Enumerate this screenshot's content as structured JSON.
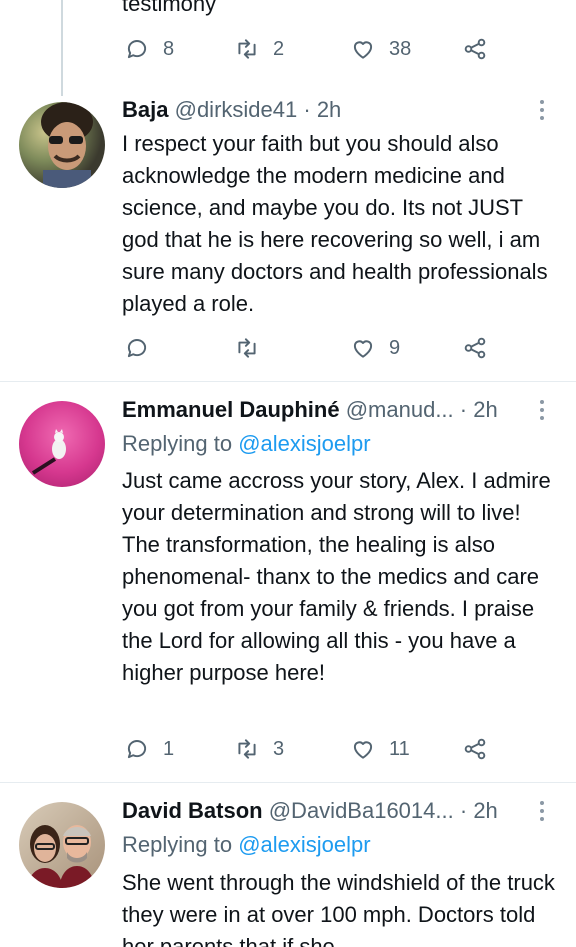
{
  "prev_tweet": {
    "tail_text": "testimony",
    "actions": {
      "replies": "8",
      "retweets": "2",
      "likes": "38"
    }
  },
  "tweets": [
    {
      "name": "Baja",
      "handle": "@dirkside41",
      "sep": "·",
      "time": "2h",
      "text": "I respect your faith but you should also acknowledge the modern medicine and science, and maybe you do. Its not JUST god that he is here recovering so well, i am sure many doctors and health professionals played a role.",
      "actions": {
        "replies": "",
        "retweets": "",
        "likes": "9"
      }
    },
    {
      "name": "Emmanuel Dauphiné",
      "handle": "@manud...",
      "sep": "·",
      "time": "2h",
      "replying_label": "Replying to",
      "replying_handle": "@alexisjoelpr",
      "text": "Just came accross your story, Alex. I admire your determination and strong will to live! The transformation, the healing is also phenomenal- thanx to the medics and care you got from your family & friends. I praise the Lord for allowing all this - you have a higher purpose here!",
      "actions": {
        "replies": "1",
        "retweets": "3",
        "likes": "11"
      }
    },
    {
      "name": "David Batson",
      "handle": "@DavidBa16014...",
      "sep": "·",
      "time": "2h",
      "replying_label": "Replying to",
      "replying_handle": "@alexisjoelpr",
      "text": "She went through the windshield of the truck they were in at over 100 mph. Doctors told her parents that if she"
    }
  ],
  "colors": {
    "text": "#0f1419",
    "secondary": "#536471",
    "link": "#1d9bf0",
    "divider": "#e6ecf0"
  }
}
